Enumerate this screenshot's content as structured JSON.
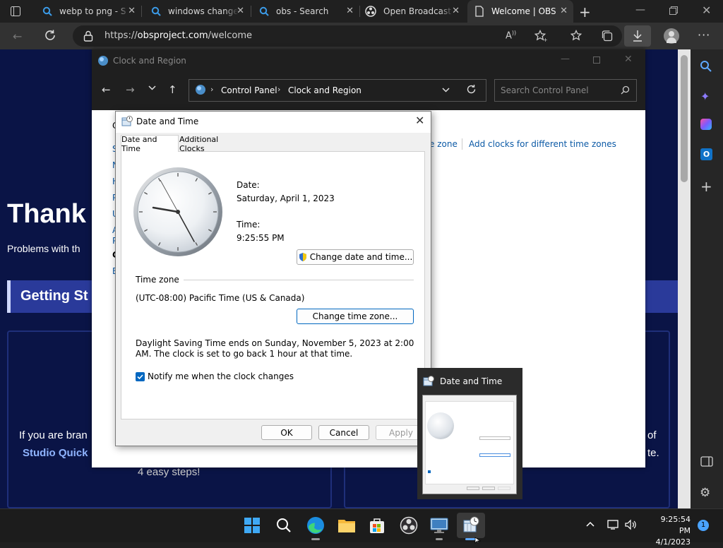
{
  "browser": {
    "tabs": [
      {
        "title": "webp to png - S",
        "icon": "bing-search-icon"
      },
      {
        "title": "windows change",
        "icon": "bing-search-icon"
      },
      {
        "title": "obs - Search",
        "icon": "bing-search-icon"
      },
      {
        "title": "Open Broadcast",
        "icon": "obs-icon"
      },
      {
        "title": "Welcome | OBS",
        "icon": "page-icon",
        "active": true
      }
    ],
    "url_prefix": "https://",
    "url_domain": "obsproject.com",
    "url_path": "/welcome"
  },
  "webpage": {
    "heading": "Thank",
    "subtext": "Problems with th",
    "banner": "Getting St",
    "bottom_text": "If you are bran",
    "bottom_link": "Studio Quick",
    "steps_text": "4 easy steps!",
    "right_of": "of",
    "right_te": "te."
  },
  "explorer": {
    "title": "Clock and Region",
    "breadcrumb": [
      "Control Panel",
      "Clock and Region"
    ],
    "search_placeholder": "Search Control Panel",
    "link_partial": "e zone",
    "link_clocks": "Add clocks for different time zones",
    "side_letters": [
      "C",
      "S",
      "N",
      "H",
      "P",
      "U",
      "A",
      "P",
      "C",
      "E"
    ]
  },
  "dialog": {
    "title": "Date and Time",
    "tabs": [
      "Date and Time",
      "Additional Clocks"
    ],
    "date_label": "Date:",
    "date_value": "Saturday, April 1, 2023",
    "time_label": "Time:",
    "time_value": "9:25:55 PM",
    "change_datetime": "Change date and time...",
    "timezone_label": "Time zone",
    "timezone_value": "(UTC-08:00) Pacific Time (US & Canada)",
    "change_timezone": "Change time zone...",
    "dst_text": "Daylight Saving Time ends on Sunday, November 5, 2023 at 2:00 AM. The clock is set to go back 1 hour at that time.",
    "notify_label": "Notify me when the clock changes",
    "notify_checked": true,
    "ok": "OK",
    "cancel": "Cancel",
    "apply": "Apply"
  },
  "thumbnail": {
    "title": "Date and Time"
  },
  "taskbar": {
    "time": "9:25:54 PM",
    "date": "4/1/2023",
    "notification_count": "1"
  },
  "colors": {
    "accent": "#0067c0",
    "webpage_bg": "#0a1446",
    "banner_bg": "#2a3a9a",
    "link_blue": "#0c5aa6"
  }
}
